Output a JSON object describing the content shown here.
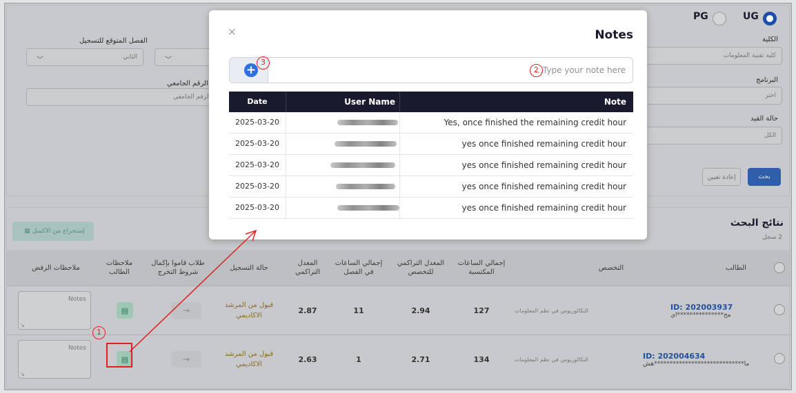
{
  "level": {
    "pg_label": "PG",
    "ug_label": "UG",
    "selected": "UG"
  },
  "filters": {
    "college_label": "الكلية",
    "college_value": "كلية تقنية المعلومات",
    "program_label": "البرنامج",
    "program_value": "اختر",
    "status_label": "حالة القيد",
    "status_value": "الكل",
    "semester_label": "الفصل المتوقع للتسجيل",
    "semester_value": "الثاني",
    "student_id_label": "الرقم الجامعي",
    "student_id_placeholder": "الرقم الجامعي",
    "search_button": "بحث",
    "reset_button": "إعادة تعيين"
  },
  "results": {
    "title": "نتائج البحث",
    "count": "2 سجل",
    "export_button": "إستخراج من الاكسل",
    "columns": {
      "student": "الطالب",
      "specialization": "التخصص",
      "earned_hours": "إجمالي الساعات المكتسبة",
      "major_gpa": "المعدل التراكمي للتخصص",
      "semester_hours": "إجمالي الساعات في الفصل",
      "cumulative_gpa": "المعدل التراكمي",
      "registration_status": "حالة التسجيل",
      "graduation_students": "طلاب قاموا بإكمال شروط التخرج",
      "student_notes": "ملاحظات الطالب",
      "rejection_notes": "ملاحظات الرفض"
    },
    "rows": [
      {
        "id": "ID: 202003937",
        "name": "مح***************اي",
        "specialization": "البكالوريوس في نظم المعلومات",
        "earned_hours": "127",
        "major_gpa": "2.94",
        "semester_hours": "11",
        "cumulative_gpa": "2.87",
        "status": "قبول من المرشد الاكاديمي",
        "notes_placeholder": "Notes"
      },
      {
        "id": "ID: 202004634",
        "name": "ما*****************************هش",
        "specialization": "البكالوريوس في نظم المعلومات",
        "earned_hours": "134",
        "major_gpa": "2.71",
        "semester_hours": "1",
        "cumulative_gpa": "2.63",
        "status": "قبول من المرشد الاكاديمي",
        "notes_placeholder": "Notes"
      }
    ]
  },
  "modal": {
    "title": "Notes",
    "close_glyph": "×",
    "input_placeholder": "...Type your note here",
    "add_glyph": "+",
    "headers": {
      "date": "Date",
      "user": "User Name",
      "note": "Note"
    },
    "rows": [
      {
        "date": "2025-03-20",
        "note": "Yes, once finished the remaining credit hour"
      },
      {
        "date": "2025-03-20",
        "note": "yes once finished remaining credit hour"
      },
      {
        "date": "2025-03-20",
        "note": "yes once finished remaining credit hour"
      },
      {
        "date": "2025-03-20",
        "note": "yes once finished remaining credit hour"
      },
      {
        "date": "2025-03-20",
        "note": "yes once finished remaining credit hour"
      }
    ]
  },
  "annotations": {
    "one": "1",
    "two": "2",
    "three": "3"
  },
  "icons": {
    "note_icon": "note-icon",
    "arrow_icon": "arrow-right-icon",
    "excel_icon": "excel-icon",
    "resize_icon": "resize-handle-icon"
  },
  "colors": {
    "primary": "#2f5fa8",
    "dark_header": "#1a1a2e",
    "note_green": "#2b7a5a",
    "annotation_red": "#e02020",
    "add_blue": "#2f6fe0"
  }
}
